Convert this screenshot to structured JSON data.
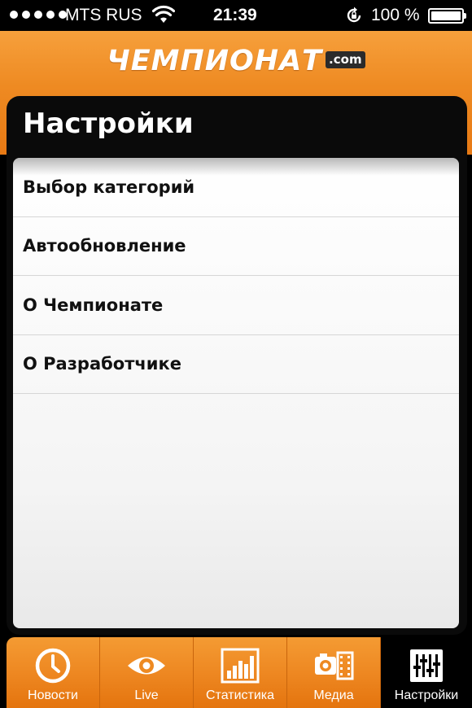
{
  "status_bar": {
    "carrier": "MTS RUS",
    "time": "21:39",
    "battery_percent": "100 %",
    "battery_level": 1.0,
    "icons": [
      "signal-dots-icon",
      "wifi-icon",
      "rotation-lock-icon",
      "battery-icon"
    ]
  },
  "header": {
    "logo_main": "ЧЕМПИОНАТ",
    "logo_suffix": ".com"
  },
  "settings": {
    "title": "Настройки",
    "items": [
      {
        "label": "Выбор категорий"
      },
      {
        "label": "Автообновление"
      },
      {
        "label": "О Чемпионате"
      },
      {
        "label": "О Разработчике"
      }
    ]
  },
  "tabs": [
    {
      "label": "Новости",
      "icon": "clock-icon",
      "active": false
    },
    {
      "label": "Live",
      "icon": "eye-icon",
      "active": false
    },
    {
      "label": "Статистика",
      "icon": "bar-chart-icon",
      "active": false
    },
    {
      "label": "Медиа",
      "icon": "camera-film-icon",
      "active": false
    },
    {
      "label": "Настройки",
      "icon": "sliders-icon",
      "active": true
    }
  ],
  "colors": {
    "brand_orange": "#ee8a22",
    "panel_black": "#0a0a0a"
  }
}
